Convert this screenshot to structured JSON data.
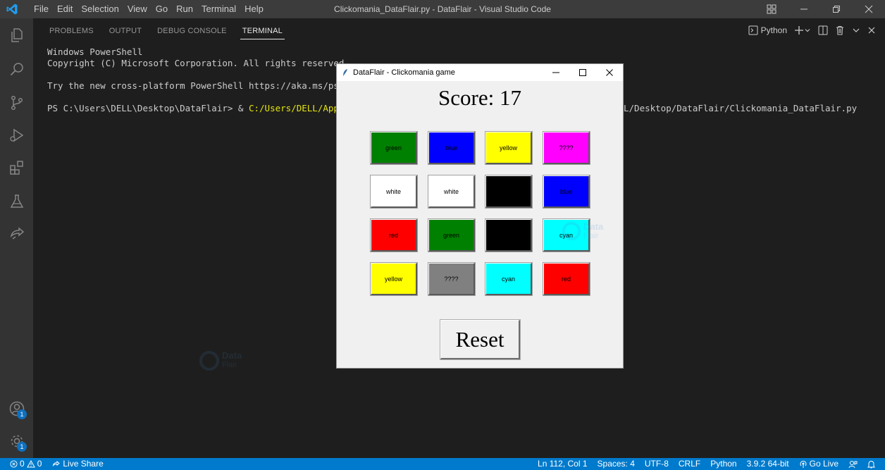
{
  "titlebar": {
    "menus": [
      "File",
      "Edit",
      "Selection",
      "View",
      "Go",
      "Run",
      "Terminal",
      "Help"
    ],
    "window_title": "Clickomania_DataFlair.py - DataFlair - Visual Studio Code"
  },
  "panel": {
    "tabs": [
      {
        "label": "PROBLEMS",
        "active": false
      },
      {
        "label": "OUTPUT",
        "active": false
      },
      {
        "label": "DEBUG CONSOLE",
        "active": false
      },
      {
        "label": "TERMINAL",
        "active": true
      }
    ],
    "shell_name": "Python"
  },
  "terminal": {
    "line1": "Windows PowerShell",
    "line2": "Copyright (C) Microsoft Corporation. All rights reserved.",
    "line3": "Try the new cross-platform PowerShell https://aka.ms/psco",
    "prompt": "PS C:\\Users\\DELL\\Desktop\\DataFlair> & ",
    "command": "C:/Users/DELL/AppDa",
    "tail": "L/Desktop/DataFlair/Clickomania_DataFlair.py"
  },
  "watermark": {
    "line1": "Data",
    "line2": "Flair"
  },
  "game": {
    "title": "DataFlair - Clickomania game",
    "score": "Score: 17",
    "reset_label": "Reset",
    "cells": [
      {
        "label": "green",
        "bg": "#008000"
      },
      {
        "label": "blue",
        "bg": "#0000ff"
      },
      {
        "label": "yellow",
        "bg": "#ffff00"
      },
      {
        "label": "????",
        "bg": "#ff00ff"
      },
      {
        "label": "white",
        "bg": "#ffffff"
      },
      {
        "label": "white",
        "bg": "#ffffff"
      },
      {
        "label": "",
        "bg": "#000000"
      },
      {
        "label": "blue",
        "bg": "#0000ff"
      },
      {
        "label": "red",
        "bg": "#ff0000"
      },
      {
        "label": "green",
        "bg": "#008000"
      },
      {
        "label": "",
        "bg": "#000000"
      },
      {
        "label": "cyan",
        "bg": "#00ffff"
      },
      {
        "label": "yellow",
        "bg": "#ffff00"
      },
      {
        "label": "????",
        "bg": "#808080"
      },
      {
        "label": "cyan",
        "bg": "#00ffff"
      },
      {
        "label": "red",
        "bg": "#ff0000"
      }
    ]
  },
  "activity": {
    "icons": [
      "explorer-icon",
      "search-icon",
      "source-control-icon",
      "run-debug-icon",
      "extensions-icon",
      "testing-icon",
      "live-share-icon"
    ],
    "accounts_badge": "1",
    "settings_badge": "1"
  },
  "statusbar": {
    "errors": "0",
    "warnings": "0",
    "live_share": "Live Share",
    "position": "Ln 112, Col 1",
    "spaces": "Spaces: 4",
    "encoding": "UTF-8",
    "eol": "CRLF",
    "language": "Python",
    "interpreter": "3.9.2 64-bit",
    "go_live": "Go Live"
  }
}
